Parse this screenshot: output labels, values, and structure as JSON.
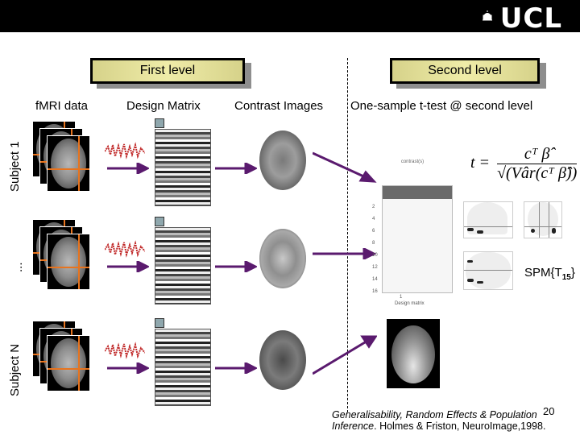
{
  "header": {
    "logo_text": "UCL",
    "logo_icon": "dome-icon"
  },
  "levels": {
    "first": "First level",
    "second": "Second level"
  },
  "columns": {
    "fmri": "fMRI data",
    "design": "Design Matrix",
    "contrast": "Contrast Images",
    "ttest": "One-sample t-test @ second level"
  },
  "rows": [
    {
      "label": "Subject 1"
    },
    {
      "label": "..."
    },
    {
      "label": "Subject N"
    }
  ],
  "formula": {
    "t": "t =",
    "numerator": "cᵀ β̂",
    "denominator": "√(Vâr(cᵀ β̂))"
  },
  "design_plot": {
    "title": "contrast(s)",
    "xlabel": "Design matrix",
    "xtick": "1",
    "yticks": [
      "2",
      "4",
      "6",
      "8",
      "10",
      "12",
      "14",
      "16"
    ]
  },
  "spm_label": {
    "base": "SPM{T",
    "sub": "15",
    "close": "}"
  },
  "citation": {
    "page": "20",
    "italic": "Generalisability, Random Effects & Population Inference",
    "rest": ". Holmes & Friston, NeuroImage,1998."
  },
  "colors": {
    "orange": "#e8741e",
    "arrow": "#5a1a6e",
    "box": "#e6e29c"
  }
}
